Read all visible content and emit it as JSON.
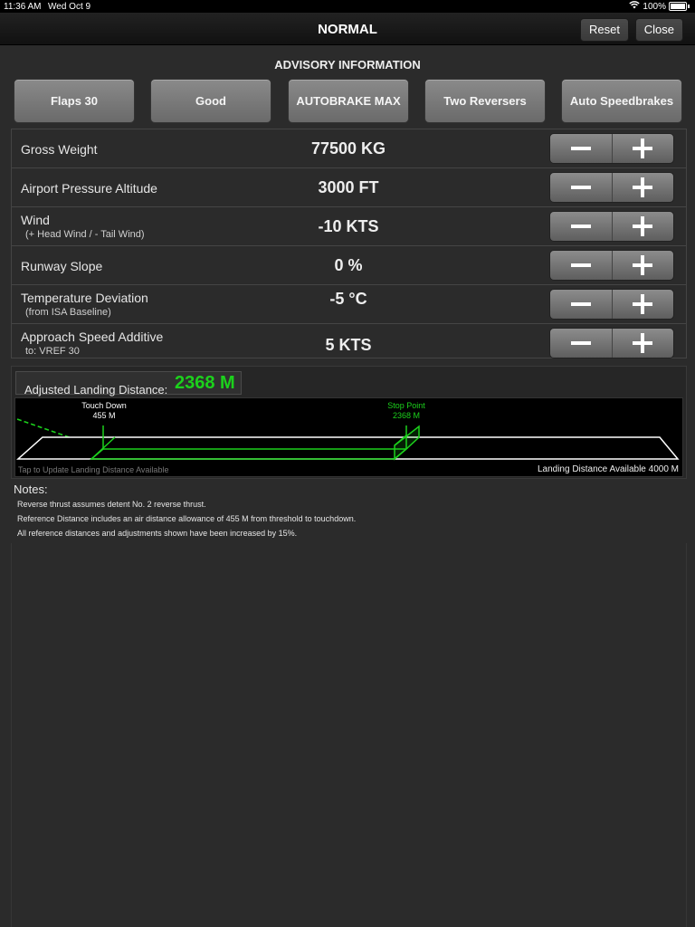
{
  "status_bar": {
    "time": "11:36 AM",
    "date": "Wed Oct 9",
    "battery": "100%"
  },
  "nav": {
    "title": "NORMAL",
    "reset_label": "Reset",
    "close_label": "Close"
  },
  "advisory": {
    "title": "ADVISORY INFORMATION",
    "chips": [
      "Flaps 30",
      "Good",
      "AUTOBRAKE MAX",
      "Two Reversers",
      "Auto Speedbrakes"
    ]
  },
  "params": [
    {
      "label": "Gross Weight",
      "sub": "",
      "value": "77500 KG"
    },
    {
      "label": "Airport Pressure Altitude",
      "sub": "",
      "value": "3000 FT"
    },
    {
      "label": "Wind",
      "sub": "(+ Head Wind / - Tail Wind)",
      "value": "-10 KTS"
    },
    {
      "label": "Runway Slope",
      "sub": "",
      "value": "0 %"
    },
    {
      "label": "Temperature Deviation",
      "sub": "(from ISA Baseline)",
      "value": "-5 °C"
    },
    {
      "label": "Approach Speed Additive",
      "sub": "to: VREF 30",
      "value": "5 KTS"
    }
  ],
  "landing": {
    "adjusted_label": "Adjusted Landing Distance:",
    "adjusted_value": "2368 M",
    "touchdown_title": "Touch Down",
    "touchdown_value": "455 M",
    "stop_title": "Stop Point",
    "stop_value": "2368 M",
    "tap_hint": "Tap to Update Landing Distance Available",
    "lda_text": "Landing Distance Available 4000 M",
    "accent_color": "#1cd11c"
  },
  "notes": {
    "title": "Notes:",
    "lines": [
      "Reverse thrust assumes detent No. 2 reverse thrust.",
      "Reference Distance includes an air distance allowance of 455 M from threshold to touchdown.",
      "All reference distances and adjustments shown have been increased by 15%."
    ]
  }
}
